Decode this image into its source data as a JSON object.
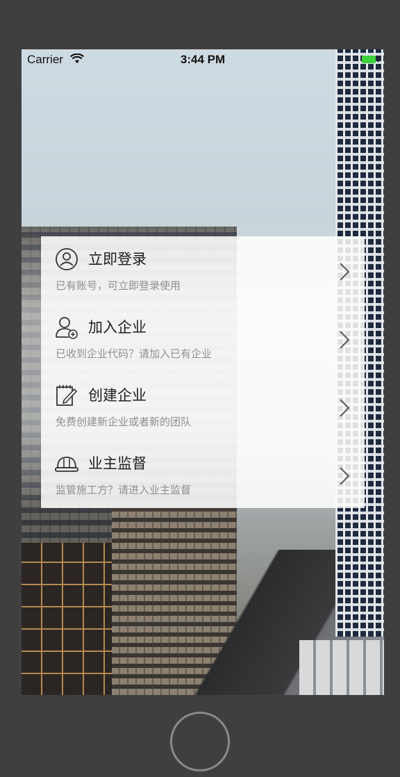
{
  "status_bar": {
    "carrier": "Carrier",
    "time": "3:44 PM",
    "battery_color": "#3bd23b"
  },
  "menu": {
    "items": [
      {
        "title": "立即登录",
        "subtitle": "已有账号，可立即登录使用",
        "icon": "user-circle-icon"
      },
      {
        "title": "加入企业",
        "subtitle": "已收到企业代码？请加入已有企业",
        "icon": "add-user-icon"
      },
      {
        "title": "创建企业",
        "subtitle": "免费创建新企业或者新的团队",
        "icon": "notepad-edit-icon"
      },
      {
        "title": "业主监督",
        "subtitle": "监管施工方？请进入业主监督",
        "icon": "hard-hat-icon"
      }
    ]
  }
}
